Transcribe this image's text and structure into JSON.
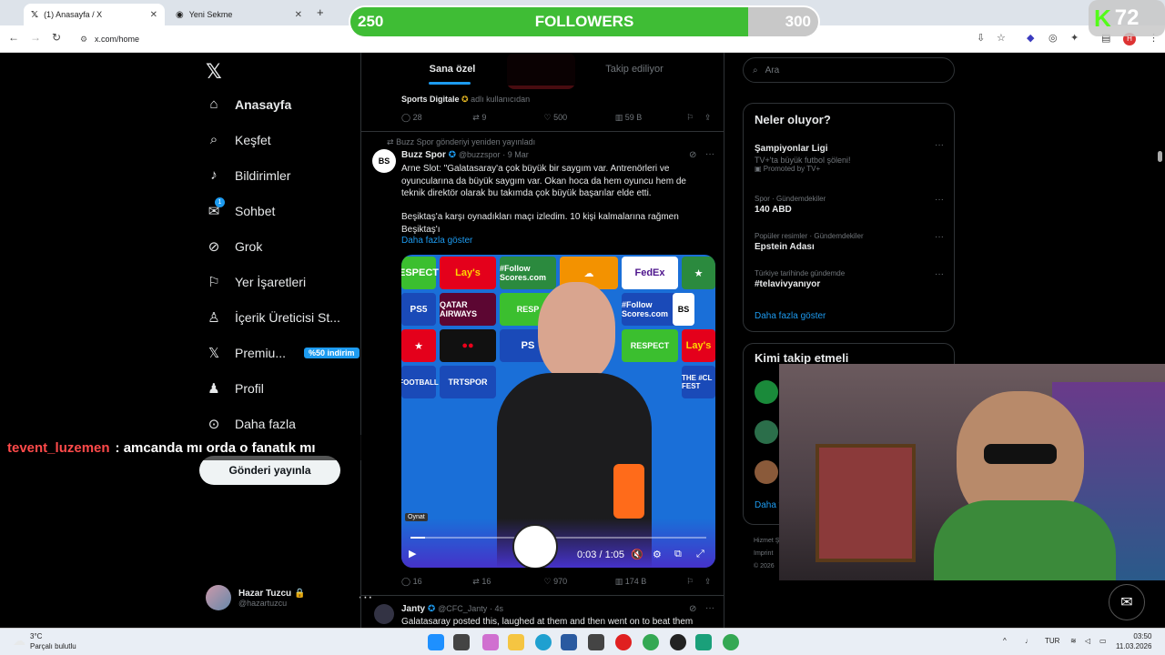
{
  "browser": {
    "tabs": [
      {
        "label": "(1) Anasayfa / X",
        "active": true
      },
      {
        "label": "Yeni Sekme",
        "active": false
      }
    ],
    "url": "x.com/home"
  },
  "overlay": {
    "followers_label": "FOLLOWERS",
    "followers_current": "250",
    "followers_goal": "300",
    "followers_progress": 0.85,
    "kick_count": "72",
    "chat_user": "tevent_luzemen",
    "chat_message": ": amcanda mı orda o fanatık mı"
  },
  "nav": {
    "items": [
      {
        "label": "Anasayfa",
        "icon": "home-icon"
      },
      {
        "label": "Keşfet",
        "icon": "search-icon"
      },
      {
        "label": "Bildirimler",
        "icon": "bell-icon"
      },
      {
        "label": "Sohbet",
        "icon": "mail-icon",
        "badge": "1"
      },
      {
        "label": "Grok",
        "icon": "grok-icon"
      },
      {
        "label": "Yer İşaretleri",
        "icon": "bookmark-icon"
      },
      {
        "label": "İçerik Üreticisi St...",
        "icon": "creator-icon"
      },
      {
        "label": "Premiu...",
        "icon": "x-premium-icon",
        "promo": "%50 indirim"
      },
      {
        "label": "Profil",
        "icon": "profile-icon"
      },
      {
        "label": "Daha fazla",
        "icon": "more-icon"
      }
    ],
    "post_button": "Gönderi yayınla",
    "user_name": "Hazar Tuzcu",
    "user_handle": "@hazartuzcu"
  },
  "timeline": {
    "tabs": [
      "Sana özel",
      "Takip ediliyor"
    ],
    "prev_post": {
      "source_name": "Sports Digitale",
      "source_suffix": "adlı kullanıcıdan",
      "replies": "28",
      "reposts": "9",
      "likes": "500",
      "views": "59 B"
    },
    "post": {
      "repost_note": "Buzz Spor gönderiyi yeniden yayınladı",
      "author": "Buzz Spor",
      "handle": "@buzzspor",
      "date": "· 9 Mar",
      "text1": "Arne Slot: \"Galatasaray'a çok büyük bir saygım var. Antrenörleri ve oyuncularına da büyük saygım var. Okan hoca da hem oyuncu hem de teknik direktör olarak bu takımda çok büyük başarılar elde etti.",
      "text2": "Beşiktaş'a karşı oynadıkları maçı izledim. 10 kişi kalmalarına rağmen Beşiktaş'ı",
      "show_more": "Daha fazla göster",
      "video_time": "0:03 / 1:05",
      "video_tooltip": "Oynat",
      "video_progress": 0.05,
      "replies": "16",
      "reposts": "16",
      "likes": "970",
      "views": "174 B",
      "ads": [
        "ESPECT",
        "Lay's",
        "#Follow Scores.com",
        "FedEx",
        "QATAR AIRWAYS",
        "RESP",
        "PS5",
        "RESPECT",
        "TRTSPOR",
        "FOOTBALL",
        "BS",
        "THE #CL FEST"
      ]
    },
    "next_post": {
      "author": "Janty",
      "handle": "@CFC_Janty",
      "date": "· 4s",
      "text": "Galatasaray posted this, laughed at them and then went on to beat them"
    }
  },
  "sidebar": {
    "search_placeholder": "Ara",
    "trends_title": "Neler oluyor?",
    "trends": [
      {
        "name": "Şampiyonlar Ligi",
        "sub": "TV+'ta büyük futbol şöleni!",
        "meta": "Promoted by TV+"
      },
      {
        "category": "Spor · Gündemdekiler",
        "name": "140 ABD"
      },
      {
        "category": "Popüler resimler · Gündemdekiler",
        "name": "Epstein Adası"
      },
      {
        "category": "Türkiye tarihinde gündemde",
        "name": "#telavivyanıyor"
      }
    ],
    "show_more": "Daha fazla göster",
    "who_to_follow": "Kimi takip etmeli",
    "who_more": "Daha f",
    "footer": [
      "Hizmet Ş",
      "Imprint",
      "© 2026"
    ]
  },
  "taskbar": {
    "weather_temp": "3°C",
    "weather_desc": "Parçalı bulutlu",
    "lang": "TUR",
    "time": "03:50",
    "date": "11.03.2026"
  },
  "colors": {
    "accent": "#1d9bf0",
    "follow_green": "#3fbd35",
    "chat_user": "#ff4a4a",
    "kick_green": "#53fc18"
  }
}
